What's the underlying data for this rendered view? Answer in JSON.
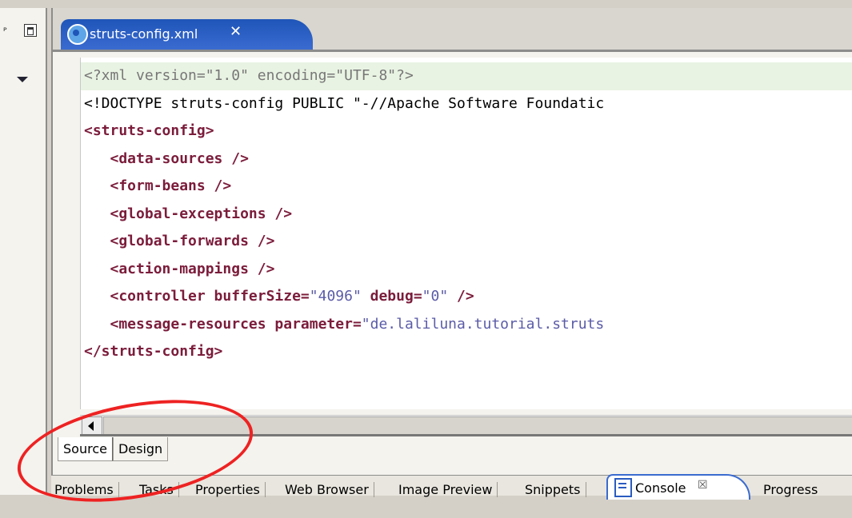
{
  "editor": {
    "tab_title": "struts-config.xml",
    "close_glyph": "✕",
    "lines": [
      {
        "parts": [
          {
            "c": "pi",
            "t": "<?xml version=\"1.0\" encoding=\"UTF-8\"?>"
          }
        ],
        "hl": true
      },
      {
        "parts": [
          {
            "c": "plain",
            "t": "<!DOCTYPE struts-config PUBLIC \"-//Apache Software Foundatic"
          }
        ]
      },
      {
        "parts": [
          {
            "c": "tag",
            "t": "<struts-config>"
          }
        ]
      },
      {
        "parts": [
          {
            "c": "tag",
            "t": "   <data-sources />"
          }
        ]
      },
      {
        "parts": [
          {
            "c": "tag",
            "t": "   <form-beans />"
          }
        ]
      },
      {
        "parts": [
          {
            "c": "tag",
            "t": "   <global-exceptions />"
          }
        ]
      },
      {
        "parts": [
          {
            "c": "tag",
            "t": "   <global-forwards />"
          }
        ]
      },
      {
        "parts": [
          {
            "c": "tag",
            "t": "   <action-mappings />"
          }
        ]
      },
      {
        "parts": [
          {
            "c": "tag",
            "t": "   <controller bufferSize="
          },
          {
            "c": "val",
            "t": "\"4096\""
          },
          {
            "c": "tag",
            "t": " debug="
          },
          {
            "c": "val",
            "t": "\"0\""
          },
          {
            "c": "tag",
            "t": " />"
          }
        ]
      },
      {
        "parts": [
          {
            "c": "tag",
            "t": "   <message-resources parameter="
          },
          {
            "c": "val",
            "t": "\"de.laliluna.tutorial.struts"
          }
        ]
      },
      {
        "parts": [
          {
            "c": "tag",
            "t": "</struts-config>"
          }
        ]
      }
    ]
  },
  "mode_tabs": {
    "source": "Source",
    "design": "Design"
  },
  "bottom_tabs": {
    "problems": "Problems",
    "tasks": "Tasks",
    "properties": "Properties",
    "web_browser": "Web Browser",
    "image_preview": "Image Preview",
    "snippets": "Snippets",
    "console": "Console",
    "console_close": "☒",
    "progress": "Progress"
  },
  "colors": {
    "tag": "#7b1c3b",
    "value": "#5b5ba8",
    "annotation": "#ee2222",
    "tab_active": "#1f55b8"
  },
  "icons": [
    "restore-icon",
    "view-menu-icon",
    "xml-file-icon",
    "close-icon",
    "scroll-left-icon",
    "console-icon"
  ]
}
